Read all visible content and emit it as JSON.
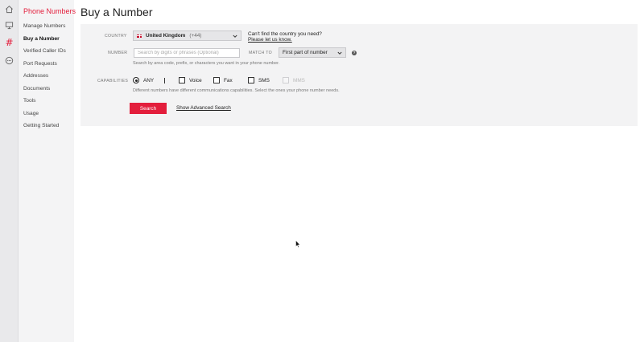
{
  "rail": {
    "icons": [
      {
        "name": "home-icon"
      },
      {
        "name": "monitor-icon"
      },
      {
        "name": "hash-icon",
        "glyph": "#"
      },
      {
        "name": "more-icon"
      }
    ],
    "accent": "#e31e3c"
  },
  "sidebar": {
    "title": "Phone Numbers",
    "items": [
      {
        "label": "Manage Numbers",
        "active": false
      },
      {
        "label": "Buy a Number",
        "active": true
      },
      {
        "label": "Verified Caller IDs",
        "active": false
      },
      {
        "label": "Port Requests",
        "active": false
      },
      {
        "label": "Addresses",
        "active": false
      },
      {
        "label": "Documents",
        "active": false
      },
      {
        "label": "Tools",
        "active": false
      },
      {
        "label": "Usage",
        "active": false
      },
      {
        "label": "Getting Started",
        "active": false
      }
    ]
  },
  "page": {
    "title": "Buy a Number"
  },
  "form": {
    "country_label": "COUNTRY",
    "country_name": "United Kingdom",
    "country_code": "(+44)",
    "country_help": "Can't find the country you need?",
    "country_help_link": "Please let us know.",
    "number_label": "NUMBER",
    "number_placeholder": "Search by digits or phrases (Optional)",
    "number_value": "",
    "number_hint": "Search by area code, prefix, or characters you want in your phone number.",
    "match_label": "MATCH TO",
    "match_value": "First part of number",
    "help_glyph": "?",
    "capabilities_label": "CAPABILITIES",
    "capabilities": {
      "any": "ANY",
      "voice": "Voice",
      "fax": "Fax",
      "sms": "SMS",
      "mms": "MMS"
    },
    "capabilities_hint": "Different numbers have different communications capabilities. Select the ones your phone number needs.",
    "search_button": "Search",
    "advanced_link": "Show Advanced Search"
  }
}
